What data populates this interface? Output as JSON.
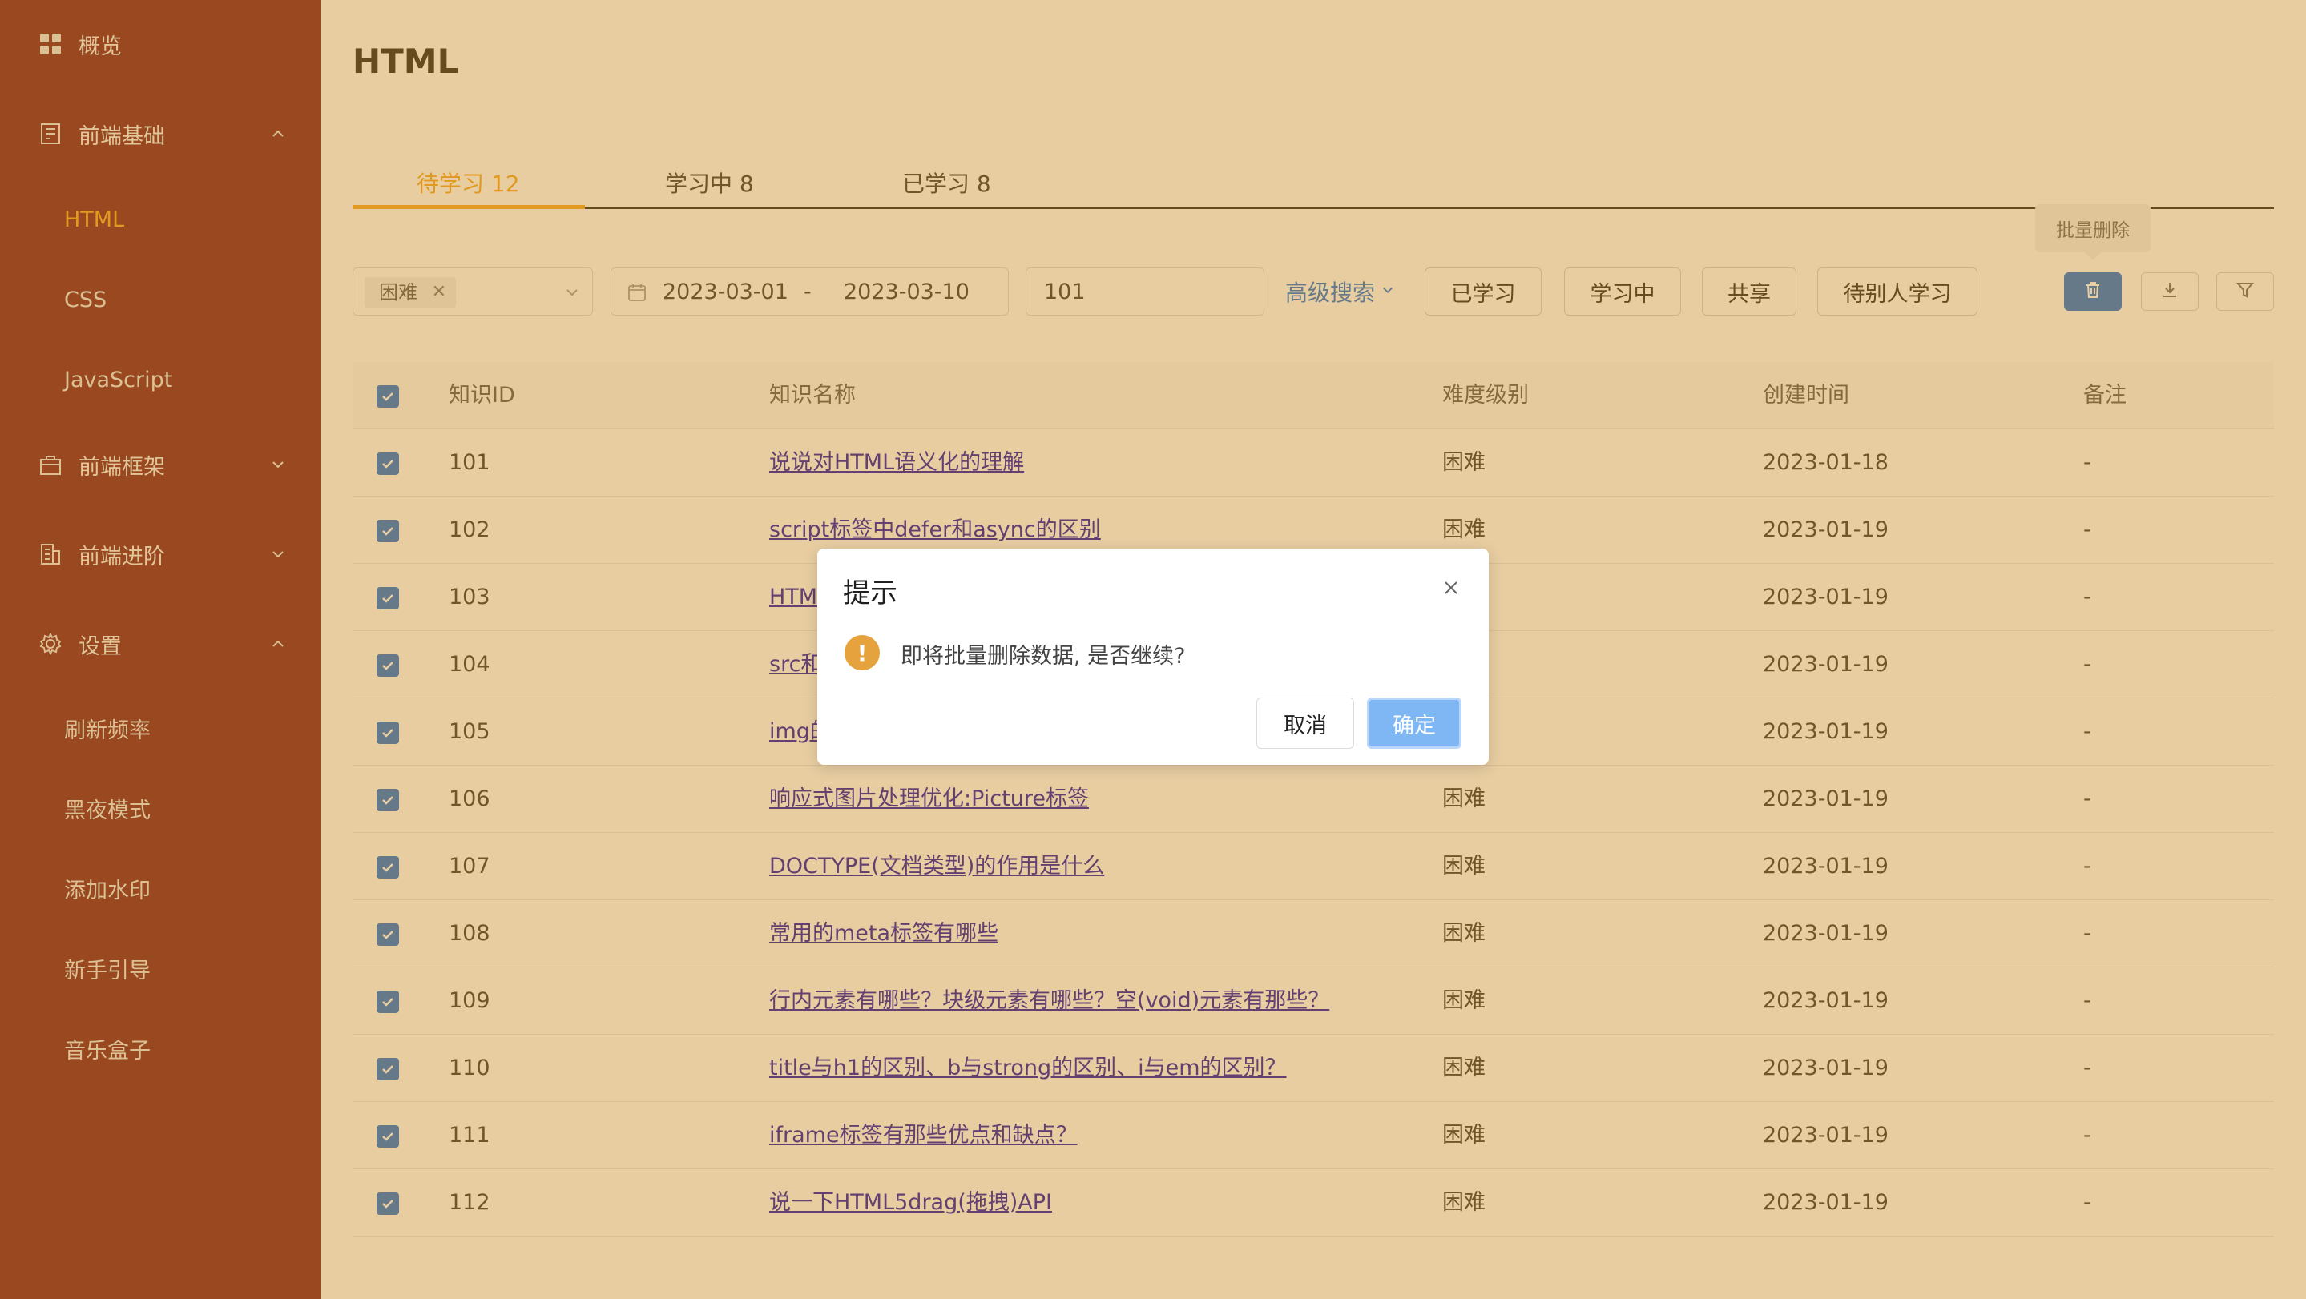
{
  "sidebar": {
    "overview": "概览",
    "group_basic": "前端基础",
    "basic_items": [
      "HTML",
      "CSS",
      "JavaScript"
    ],
    "group_framework": "前端框架",
    "group_advanced": "前端进阶",
    "group_settings": "设置",
    "settings_items": [
      "刷新频率",
      "黑夜模式",
      "添加水印",
      "新手引导",
      "音乐盒子"
    ],
    "active_item": "HTML"
  },
  "header": {
    "title": "HTML"
  },
  "tabs": [
    {
      "label": "待学习 12",
      "active": true
    },
    {
      "label": "学习中 8",
      "active": false
    },
    {
      "label": "已学习 8",
      "active": false
    }
  ],
  "filters": {
    "difficulty_tag": "困难",
    "date_start": "2023-03-01",
    "date_sep": "-",
    "date_end": "2023-03-10",
    "search_value": "101",
    "advanced_search": "高级搜索"
  },
  "actions": {
    "learned": "已学习",
    "learning": "学习中",
    "share": "共享",
    "wait_others": "待别人学习",
    "tooltip_batch_delete": "批量删除"
  },
  "table": {
    "columns": [
      "知识ID",
      "知识名称",
      "难度级别",
      "创建时间",
      "备注"
    ],
    "rows": [
      {
        "id": "101",
        "name": "说说对HTML语义化的理解",
        "level": "困难",
        "created": "2023-01-18",
        "note": "-"
      },
      {
        "id": "102",
        "name": "script标签中defer和async的区别",
        "level": "困难",
        "created": "2023-01-19",
        "note": "-"
      },
      {
        "id": "103",
        "name": "HTM",
        "level": "",
        "created": "2023-01-19",
        "note": "-"
      },
      {
        "id": "104",
        "name": "src和",
        "level": "",
        "created": "2023-01-19",
        "note": "-"
      },
      {
        "id": "105",
        "name": "img的",
        "level": "",
        "created": "2023-01-19",
        "note": "-"
      },
      {
        "id": "106",
        "name": "响应式图片处理优化:Picture标签",
        "level": "困难",
        "created": "2023-01-19",
        "note": "-"
      },
      {
        "id": "107",
        "name": "DOCTYPE(文档类型)的作用是什么",
        "level": "困难",
        "created": "2023-01-19",
        "note": "-"
      },
      {
        "id": "108",
        "name": "常用的meta标签有哪些",
        "level": "困难",
        "created": "2023-01-19",
        "note": "-"
      },
      {
        "id": "109",
        "name": "行内元素有哪些？块级元素有哪些？空(void)元素有那些？",
        "level": "困难",
        "created": "2023-01-19",
        "note": "-"
      },
      {
        "id": "110",
        "name": "title与h1的区别、b与strong的区别、i与em的区别？",
        "level": "困难",
        "created": "2023-01-19",
        "note": "-"
      },
      {
        "id": "111",
        "name": "iframe标签有那些优点和缺点？",
        "level": "困难",
        "created": "2023-01-19",
        "note": "-"
      },
      {
        "id": "112",
        "name": "说一下HTML5drag(拖拽)API",
        "level": "困难",
        "created": "2023-01-19",
        "note": "-"
      }
    ]
  },
  "dialog": {
    "title": "提示",
    "message": "即将批量删除数据, 是否继续?",
    "cancel": "取消",
    "confirm": "确定"
  },
  "colors": {
    "sidebar_bg": "#781a22",
    "accent": "#f5a623",
    "primary": "#1f6fd6",
    "overlay": "rgba(200,135,30,0.42)",
    "warning": "#e6a23c"
  }
}
